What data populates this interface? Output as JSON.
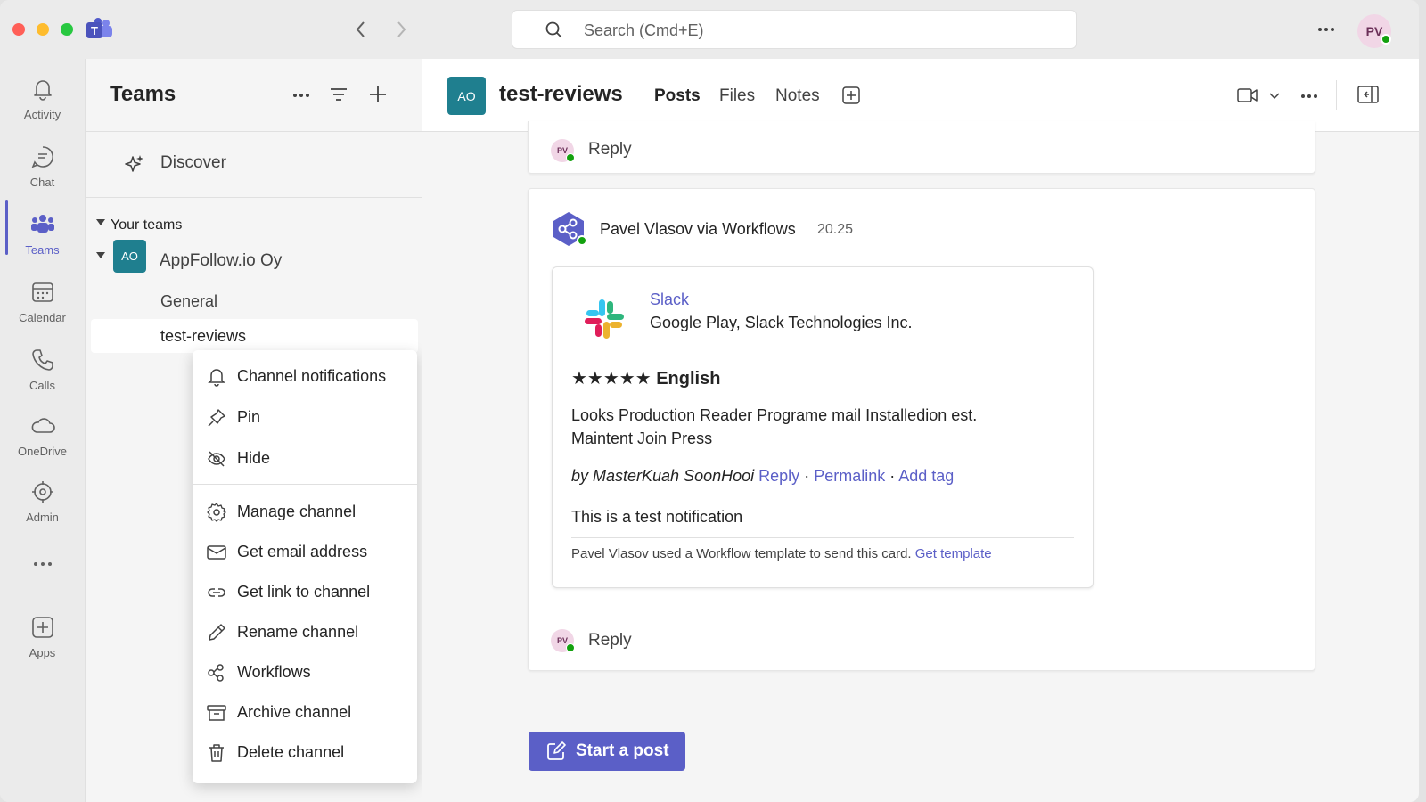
{
  "titlebar": {
    "search_placeholder": "Search (Cmd+E)",
    "user_initials": "PV"
  },
  "rail": {
    "items": [
      {
        "label": "Activity",
        "icon": "bell-icon"
      },
      {
        "label": "Chat",
        "icon": "chat-icon"
      },
      {
        "label": "Teams",
        "icon": "teams-icon"
      },
      {
        "label": "Calendar",
        "icon": "calendar-icon"
      },
      {
        "label": "Calls",
        "icon": "phone-icon"
      },
      {
        "label": "OneDrive",
        "icon": "cloud-icon"
      },
      {
        "label": "Admin",
        "icon": "admin-icon"
      },
      {
        "label": "Apps",
        "icon": "apps-add-icon"
      }
    ],
    "more": "•••"
  },
  "teams_panel": {
    "title": "Teams",
    "discover": "Discover",
    "your_teams": "Your teams",
    "team": {
      "initials": "AO",
      "name": "AppFollow.io Oy"
    },
    "channels": [
      "General",
      "test-reviews"
    ]
  },
  "context_menu": {
    "items": [
      {
        "label": "Channel notifications",
        "icon": "bell-icon"
      },
      {
        "label": "Pin",
        "icon": "pin-icon"
      },
      {
        "label": "Hide",
        "icon": "hide-icon"
      },
      {
        "label": "Manage channel",
        "icon": "gear-icon"
      },
      {
        "label": "Get email address",
        "icon": "mail-icon"
      },
      {
        "label": "Get link to channel",
        "icon": "link-icon"
      },
      {
        "label": "Rename channel",
        "icon": "pencil-icon"
      },
      {
        "label": "Workflows",
        "icon": "workflows-icon"
      },
      {
        "label": "Archive channel",
        "icon": "archive-icon"
      },
      {
        "label": "Delete channel",
        "icon": "trash-icon"
      }
    ]
  },
  "channel": {
    "initials": "AO",
    "title": "test-reviews",
    "tabs": [
      "Posts",
      "Files",
      "Notes"
    ]
  },
  "posts": {
    "reply_label": "Reply",
    "reply_avatar": "PV",
    "message": {
      "author": "Pavel Vlasov via Workflows",
      "time": "20.25",
      "card": {
        "app_name": "Slack",
        "store_publisher": "Google Play, Slack Technologies Inc.",
        "stars": "★★★★★",
        "language": "English",
        "review_line1": "Looks Production Reader Programe mail Installedion est.",
        "review_line2": "Maintent Join Press",
        "by": "by MasterKuah SoonHooi",
        "link_reply": "Reply",
        "sep": "·",
        "link_permalink": "Permalink",
        "link_addtag": "Add tag",
        "note": "This is a test notification",
        "footer": "Pavel Vlasov used a Workflow template to send this card.",
        "footer_link": "Get template"
      }
    },
    "start_post": "Start a post"
  },
  "colors": {
    "accent": "#5b5fc7",
    "team_avatar": "#1f7f8f",
    "presence": "#13a10e"
  }
}
